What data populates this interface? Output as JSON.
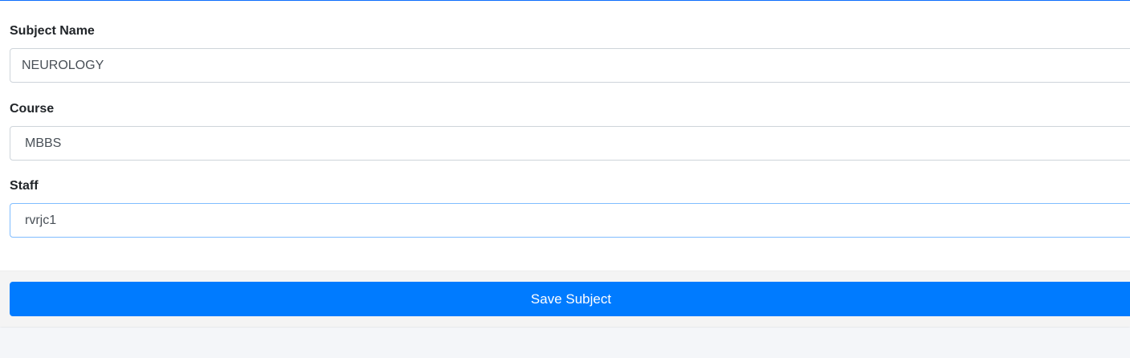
{
  "form": {
    "subject_name": {
      "label": "Subject Name",
      "value": "NEUROLOGY"
    },
    "course": {
      "label": "Course",
      "value": "MBBS"
    },
    "staff": {
      "label": "Staff",
      "value": "rvrjc1"
    }
  },
  "footer": {
    "save_label": "Save Subject"
  },
  "colors": {
    "accent": "#007bff",
    "top_border": "#0d6efd",
    "page_background": "#f4f6f9"
  }
}
